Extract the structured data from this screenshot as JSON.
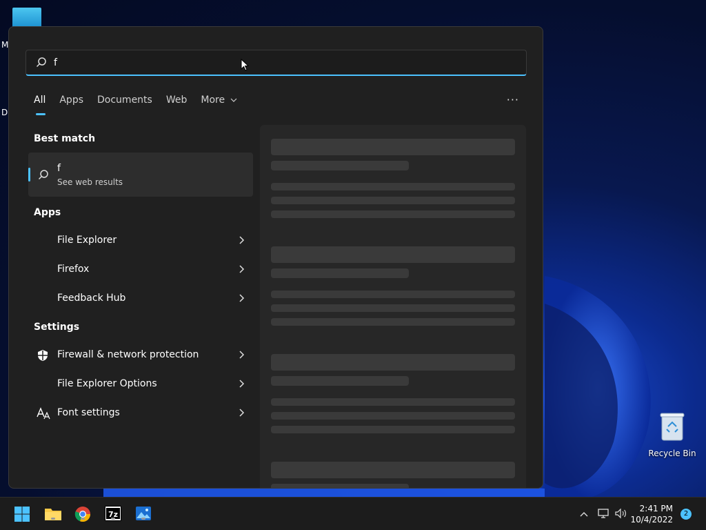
{
  "desktop": {
    "edge_text_top": "M",
    "edge_text_mid": "D:",
    "recycle_bin_label": "Recycle Bin"
  },
  "search": {
    "value": "f",
    "icon": "search-icon"
  },
  "tabs": [
    {
      "label": "All",
      "active": true
    },
    {
      "label": "Apps"
    },
    {
      "label": "Documents"
    },
    {
      "label": "Web"
    },
    {
      "label": "More"
    }
  ],
  "more_menu": "···",
  "best_match": {
    "heading": "Best match",
    "title": "f",
    "subtitle": "See web results"
  },
  "apps": {
    "heading": "Apps",
    "items": [
      {
        "label": "File Explorer",
        "icon": "file-explorer-icon"
      },
      {
        "label": "Firefox",
        "icon": "firefox-icon"
      },
      {
        "label": "Feedback Hub",
        "icon": "feedback-hub-icon"
      }
    ]
  },
  "settings": {
    "heading": "Settings",
    "items": [
      {
        "label": "Firewall & network protection",
        "icon": "shield-icon"
      },
      {
        "label": "File Explorer Options",
        "icon": "file-explorer-options-icon"
      },
      {
        "label": "Font settings",
        "icon": "font-settings-icon"
      }
    ]
  },
  "taskbar": {
    "time": "2:41 PM",
    "date": "10/4/2022",
    "notification_count": "2",
    "apps": [
      "start-icon",
      "file-explorer-icon",
      "chrome-icon",
      "7zip-icon",
      "photos-icon"
    ]
  },
  "colors": {
    "accent": "#4cc2ff",
    "panel_bg": "#202020"
  }
}
